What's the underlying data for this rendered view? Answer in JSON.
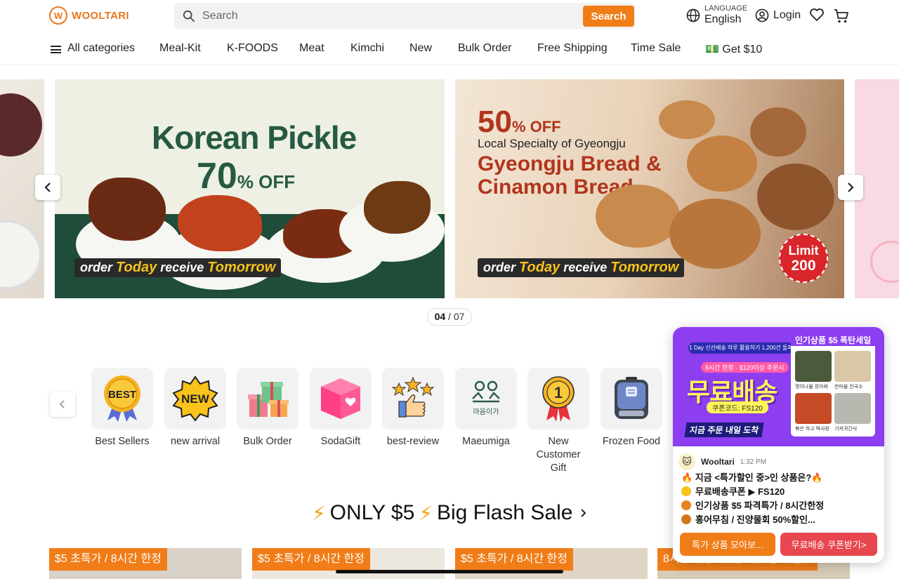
{
  "header": {
    "logo_text": "WOOLTARI",
    "search": {
      "placeholder": "Search",
      "button_label": "Search"
    },
    "language": {
      "small_label": "LANGUAGE",
      "value": "English"
    },
    "login_label": "Login"
  },
  "nav": {
    "items": [
      {
        "label": "All categories"
      },
      {
        "label": "Meal-Kit"
      },
      {
        "label": "K-FOODS"
      },
      {
        "label": "Meat"
      },
      {
        "label": "Kimchi"
      },
      {
        "label": "New"
      },
      {
        "label": "Bulk Order"
      },
      {
        "label": "Free Shipping"
      },
      {
        "label": "Time Sale"
      },
      {
        "label": "💵 Get $10"
      }
    ]
  },
  "carousel": {
    "slide_a": {
      "title": "Korean Pickle",
      "discount": "70",
      "discount_suffix": "% OFF",
      "tag_order": "order",
      "tag_today": "Today",
      "tag_receive": "receive",
      "tag_tomorrow": "Tomorrow"
    },
    "slide_b": {
      "discount": "50",
      "discount_suffix": "% OFF",
      "subtitle": "Local Specialty of Gyeongju",
      "title_line1": "Gyeongju Bread &",
      "title_line2": "Cinamon Bread",
      "limit_label": "Limit",
      "limit_value": "200",
      "tag_order": "order",
      "tag_today": "Today",
      "tag_receive": "receive",
      "tag_tomorrow": "Tomorrow"
    },
    "pager_current": "04",
    "pager_sep": " / ",
    "pager_total": "07"
  },
  "categories": [
    {
      "label": "Best Sellers",
      "icon": "best-badge-icon"
    },
    {
      "label": "new arrival",
      "icon": "new-badge-icon"
    },
    {
      "label": "Bulk Order",
      "icon": "gift-boxes-icon"
    },
    {
      "label": "SodaGift",
      "icon": "heart-box-icon"
    },
    {
      "label": "best-review",
      "icon": "thumbs-up-stars-icon"
    },
    {
      "label": "Maeumiga",
      "icon": "maeumiga-logo-icon",
      "icon_text": "마음이가"
    },
    {
      "label": "New Customer Gift",
      "icon": "first-medal-icon"
    },
    {
      "label": "Frozen Food",
      "icon": "freezer-icon"
    }
  ],
  "flash_sale": {
    "title_part1": "ONLY $5",
    "title_part2": "Big Flash Sale",
    "products": [
      {
        "badge": "$5 초특가 / 8시간 한정"
      },
      {
        "badge": "$5 초특가 / 8시간 한정"
      },
      {
        "badge": "$5 초특가 / 8시간 한정"
      },
      {
        "badge": "8시간 한정 / 유통기한 임박 할인"
      }
    ]
  },
  "chat": {
    "banner": {
      "pill": "1 Day 신선배송 하루 활용하기 1,200건 돌파",
      "sub": "8시간 한정 · $120이상 주문시",
      "big": "무료배송",
      "code": "쿠폰코드: FS120",
      "bottom": "지금 주문 내일 도착",
      "right_title": "인기상품 $5 폭탄세일",
      "thumbs": [
        "명이나물 장아찌",
        "천마물 잔국수",
        "볶은 하고 떡사랑",
        "기저귀간식"
      ]
    },
    "sender": "Wooltari",
    "time": "1:32 PM",
    "lines": [
      "🔥 지금 <특가할인 중>인 상품은?🔥",
      "무료배송쿠폰 ▶ FS120",
      "인기상품 $5 파격특가 / 8시간한정",
      "홍어무침 / 진양물회 50%할인..."
    ],
    "button_left": "특가 상품 모아보...",
    "button_right": "무료배송 쿠폰받기>"
  },
  "colors": {
    "brand_orange": "#f07d18",
    "chat_red": "#e8474f",
    "chat_purple": "#8c3ef0"
  }
}
